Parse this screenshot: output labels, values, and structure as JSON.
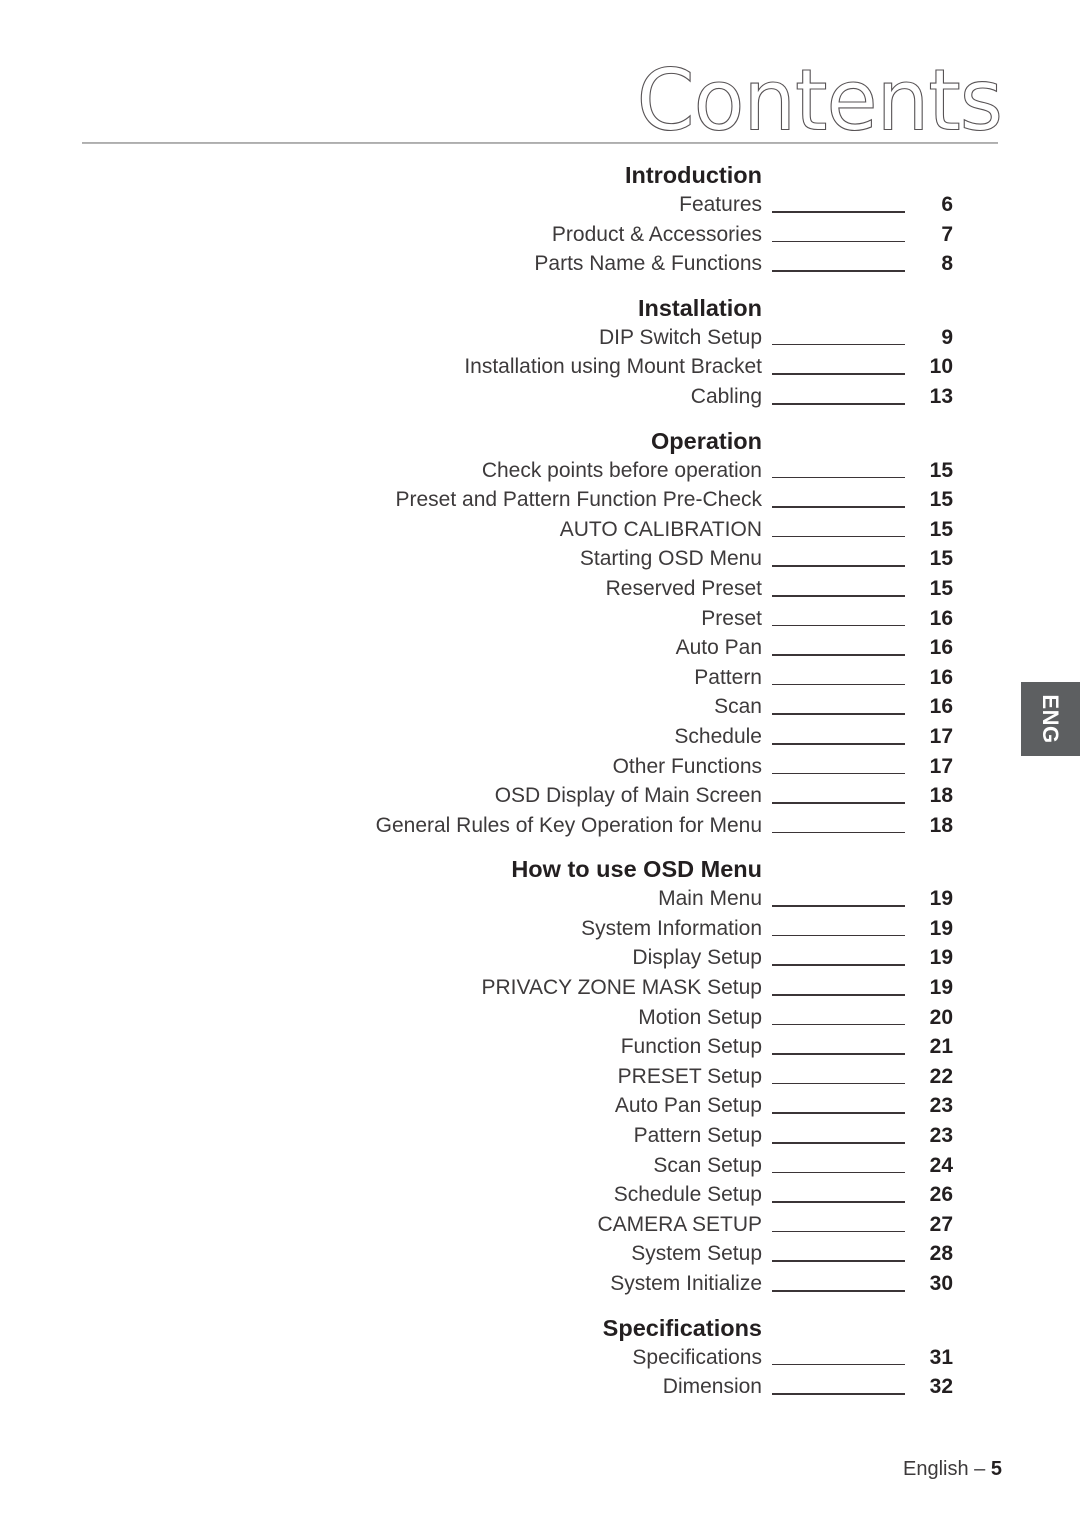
{
  "document": {
    "title": "Contents",
    "footer_prefix": "English –",
    "footer_page": "5"
  },
  "side_tab": {
    "label": "ENG",
    "background_color": "#5d5f61",
    "text_color": "#ffffff"
  },
  "colors": {
    "body_text": "#3d3a3b",
    "heading_text": "#231f20",
    "rule": "#9a9a9a",
    "leader": "#3b3537"
  },
  "toc": {
    "sections": [
      {
        "title": "Introduction",
        "entries": [
          {
            "label": "Features",
            "page": "6"
          },
          {
            "label": "Product & Accessories",
            "page": "7"
          },
          {
            "label": "Parts Name & Functions",
            "page": "8"
          }
        ]
      },
      {
        "title": "Installation",
        "entries": [
          {
            "label": "DIP Switch Setup",
            "page": "9"
          },
          {
            "label": "Installation using Mount Bracket",
            "page": "10"
          },
          {
            "label": "Cabling",
            "page": "13"
          }
        ]
      },
      {
        "title": "Operation",
        "entries": [
          {
            "label": "Check points before operation",
            "page": "15"
          },
          {
            "label": "Preset and Pattern Function Pre-Check",
            "page": "15"
          },
          {
            "label": "AUTO CALIBRATION",
            "page": "15"
          },
          {
            "label": "Starting OSD Menu",
            "page": "15"
          },
          {
            "label": "Reserved Preset",
            "page": "15"
          },
          {
            "label": "Preset",
            "page": "16"
          },
          {
            "label": "Auto Pan",
            "page": "16"
          },
          {
            "label": "Pattern",
            "page": "16"
          },
          {
            "label": "Scan",
            "page": "16"
          },
          {
            "label": "Schedule",
            "page": "17"
          },
          {
            "label": "Other Functions",
            "page": "17"
          },
          {
            "label": "OSD Display of Main Screen",
            "page": "18"
          },
          {
            "label": "General Rules of Key Operation for Menu",
            "page": "18"
          }
        ]
      },
      {
        "title": "How to use OSD Menu",
        "entries": [
          {
            "label": "Main Menu",
            "page": "19"
          },
          {
            "label": "System Information",
            "page": "19"
          },
          {
            "label": "Display Setup",
            "page": "19"
          },
          {
            "label": "PRIVACY ZONE MASK Setup",
            "page": "19"
          },
          {
            "label": "Motion Setup",
            "page": "20"
          },
          {
            "label": "Function Setup",
            "page": "21"
          },
          {
            "label": "PRESET Setup",
            "page": "22"
          },
          {
            "label": "Auto Pan Setup",
            "page": "23"
          },
          {
            "label": "Pattern Setup",
            "page": "23"
          },
          {
            "label": "Scan Setup",
            "page": "24"
          },
          {
            "label": "Schedule Setup",
            "page": "26"
          },
          {
            "label": "CAMERA SETUP",
            "page": "27"
          },
          {
            "label": "System Setup",
            "page": "28"
          },
          {
            "label": "System Initialize",
            "page": "30"
          }
        ]
      },
      {
        "title": "Specifications",
        "entries": [
          {
            "label": "Specifications",
            "page": "31"
          },
          {
            "label": "Dimension",
            "page": "32"
          }
        ]
      }
    ]
  }
}
